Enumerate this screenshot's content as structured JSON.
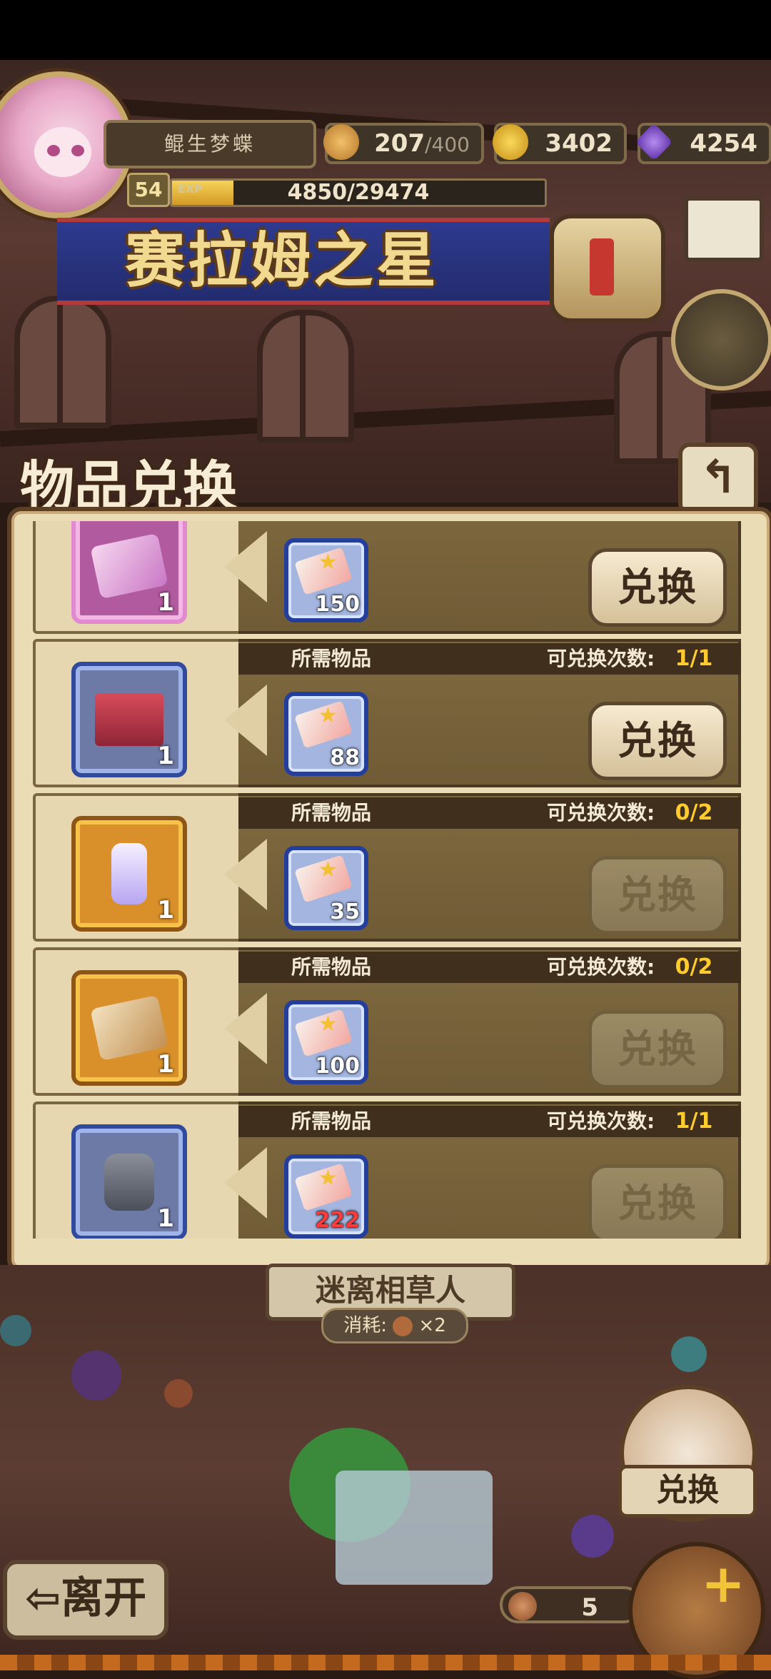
{
  "player": {
    "name": "鲲生梦蝶",
    "level": "54",
    "exp_label": "EXP",
    "exp": "4850/29474",
    "exp_fraction": 0.1646
  },
  "resources": {
    "stamina": "207",
    "stamina_max": "/400",
    "gold": "3402",
    "gems": "4254"
  },
  "location_title": "赛拉姆之星",
  "panel": {
    "title": "物品兑换",
    "back_icon": "back-arrow-icon",
    "required_label": "所需物品",
    "count_label": "可兑换次数:",
    "exchange_label": "兑换"
  },
  "rows": [
    {
      "reward": "ticket-pink",
      "qty": "1",
      "frame": "pink",
      "cost": "150",
      "count": "",
      "enabled": true
    },
    {
      "reward": "gift-box",
      "qty": "1",
      "frame": "blue",
      "cost": "88",
      "count": "1/1",
      "enabled": true
    },
    {
      "reward": "winged-bottle",
      "qty": "1",
      "frame": "gold",
      "cost": "35",
      "count": "0/2",
      "enabled": false
    },
    {
      "reward": "ticket-gold",
      "qty": "1",
      "frame": "gold",
      "cost": "100",
      "count": "0/2",
      "enabled": false
    },
    {
      "reward": "character-figure",
      "qty": "1",
      "frame": "blue",
      "cost": "222",
      "count": "1/1",
      "enabled": false
    }
  ],
  "bottom": {
    "sign_text": "迷离相草人",
    "cost_label": "消耗:",
    "cost_multiplier": "×2",
    "exchange_shop_label": "兑换",
    "leave_label": "⇦离开",
    "ticket_count": "5"
  },
  "colors": {
    "accent_gold": "#ffcb2f",
    "cost_red": "#ff3b3b"
  }
}
